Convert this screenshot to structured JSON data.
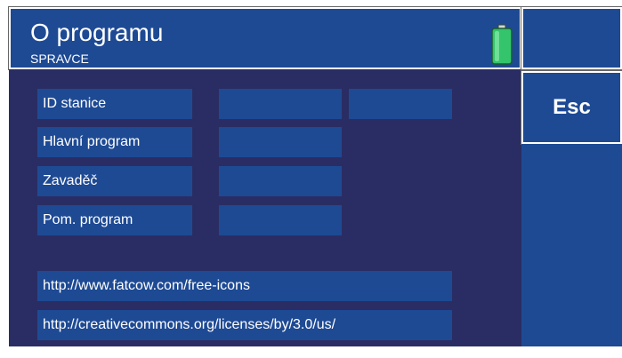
{
  "header": {
    "title": "O programu",
    "subtitle": "SPRAVCE",
    "battery_icon": "battery-full-icon",
    "battery_color": "#34c46b"
  },
  "info": {
    "rows": [
      {
        "label": "ID stanice",
        "value": "",
        "value2": ""
      },
      {
        "label": "Hlavní program",
        "value": ""
      },
      {
        "label": "Zavaděč",
        "value": ""
      },
      {
        "label": "Pom. program",
        "value": ""
      }
    ],
    "links": [
      "http://www.fatcow.com/free-icons",
      "http://creativecommons.org/licenses/by/3.0/us/"
    ]
  },
  "sidebar": {
    "esc_label": "Esc"
  },
  "colors": {
    "panel_blue": "#1e4a94",
    "background_navy": "#2a2d63",
    "text": "#ffffff"
  }
}
